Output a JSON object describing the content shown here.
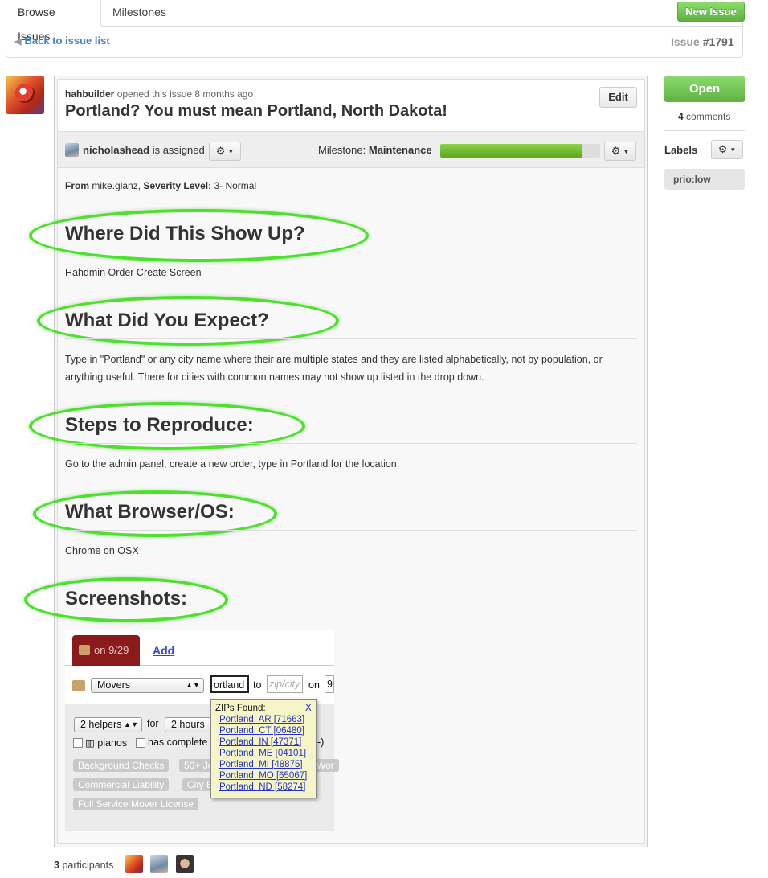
{
  "tabs": {
    "browse": "Browse Issues",
    "milestones": "Milestones"
  },
  "new_issue": "New Issue",
  "back_link": "Back to issue list",
  "issue_label": "Issue",
  "issue_number": "#1791",
  "issue": {
    "author": "hahbuilder",
    "opened_text": "opened this issue 8 months ago",
    "title": "Portland? You must mean Portland, North Dakota!",
    "edit": "Edit",
    "assignee": "nicholashead",
    "assigned_text": "is assigned",
    "milestone_label": "Milestone:",
    "milestone_name": "Maintenance",
    "milestone_progress": 0.89
  },
  "body": {
    "from_label": "From",
    "from_value": "mike.glanz,",
    "severity_label": "Severity Level:",
    "severity_value": "3- Normal",
    "sections": [
      {
        "heading": "Where Did This Show Up?",
        "text": "Hahdmin Order Create Screen -"
      },
      {
        "heading": "What Did You Expect?",
        "text": "Type in \"Portland\" or any city name where their are multiple states and they are listed alphabetically, not by population, or anything useful. There for cities with common names may not show up listed in the drop down."
      },
      {
        "heading": "Steps to Reproduce:",
        "text": "Go to the admin panel, create a new order, type in Portland for the location."
      },
      {
        "heading": "What Browser/OS:",
        "text": "Chrome on OSX"
      },
      {
        "heading": "Screenshots:",
        "text": ""
      }
    ]
  },
  "screenshot": {
    "tab_label": "on 9/29",
    "add_link": "Add",
    "service_select": "Movers",
    "from_input": "ortland",
    "to_text": "to",
    "to_placeholder": "zip/city",
    "on_text": "on",
    "date_value": "9.",
    "helpers_select": "2 helpers",
    "for_text": "for",
    "hours_select": "2 hours",
    "pianos_text": "pianos",
    "has_complete_text": "has complete",
    "partial_text": "-)",
    "tags": [
      "Background Checks",
      "50+ Jo",
      "Wor",
      "Commercial Liability",
      "City B",
      "Full Service Mover License"
    ],
    "zip_title": "ZIPs Found:",
    "zip_close": "X",
    "zips": [
      "Portland, AR [71663]",
      "Portland, CT [06480]",
      "Portland, IN [47371]",
      "Portland, ME [04101]",
      "Portland, MI [48875]",
      "Portland, MO [65067]",
      "Portland, ND [58274]"
    ]
  },
  "sidebar": {
    "status_button": "Open",
    "comment_count": "4",
    "comments_text": "comments",
    "labels_heading": "Labels",
    "label": "prio:low"
  },
  "footer": {
    "participant_count": "3",
    "participants_text": "participants"
  },
  "colors": {
    "green": "#6cc644",
    "link": "#4183c4",
    "highlight": "#4ee02e"
  }
}
